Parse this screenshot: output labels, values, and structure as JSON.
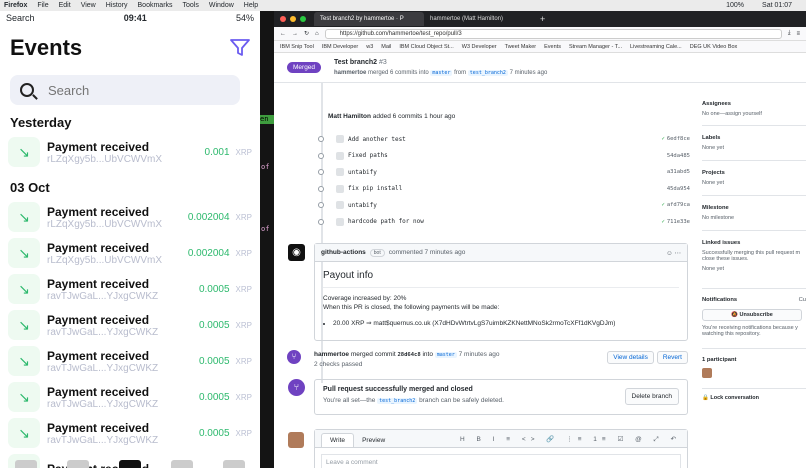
{
  "menubar": {
    "app": "Firefox",
    "items": [
      "File",
      "Edit",
      "View",
      "History",
      "Bookmarks",
      "Tools",
      "Window",
      "Help"
    ],
    "battery": "100%",
    "clock": "Sat 01:07"
  },
  "phone": {
    "status_left": "Search",
    "time": "09:41",
    "battery": "54%",
    "title": "Events",
    "search_placeholder": "Search",
    "sections": [
      {
        "label": "Yesterday",
        "rows": [
          {
            "title": "Payment received",
            "sub": "rLZqXgy5b...UbVCWVmX",
            "amount": "0.001",
            "unit": "XRP"
          }
        ]
      },
      {
        "label": "03 Oct",
        "rows": [
          {
            "title": "Payment received",
            "sub": "rLZqXgy5b...UbVCWVmX",
            "amount": "0.002004",
            "unit": "XRP"
          },
          {
            "title": "Payment received",
            "sub": "rLZqXgy5b...UbVCWVmX",
            "amount": "0.002004",
            "unit": "XRP"
          },
          {
            "title": "Payment received",
            "sub": "ravTJwGaL...YJxgCWKZ",
            "amount": "0.0005",
            "unit": "XRP"
          },
          {
            "title": "Payment received",
            "sub": "ravTJwGaL...YJxgCWKZ",
            "amount": "0.0005",
            "unit": "XRP"
          },
          {
            "title": "Payment received",
            "sub": "ravTJwGaL...YJxgCWKZ",
            "amount": "0.0005",
            "unit": "XRP"
          },
          {
            "title": "Payment received",
            "sub": "ravTJwGaL...YJxgCWKZ",
            "amount": "0.0005",
            "unit": "XRP"
          },
          {
            "title": "Payment received",
            "sub": "ravTJwGaL...YJxgCWKZ",
            "amount": "0.0005",
            "unit": "XRP"
          },
          {
            "title": "Payment received",
            "sub": "",
            "amount": "",
            "unit": ""
          }
        ]
      }
    ]
  },
  "strip": {
    "green_text": "en",
    "pink": [
      "of",
      "of"
    ]
  },
  "browser": {
    "tabs": [
      "Test branch2 by hammertoe · P",
      "hammertoe (Matt Hamilton)"
    ],
    "url": "https://github.com/hammertoe/test_repo/pull/3",
    "bookmarks": [
      "IBM Snip Tool",
      "IBM Developer",
      "w3",
      "Mail",
      "IBM Cloud Object St...",
      "W3 Developer",
      "Tweet Maker",
      "Events",
      "Stream Manager - T...",
      "Livestreaming Cale...",
      "DEG UK Video Box"
    ]
  },
  "pr": {
    "badge": "Merged",
    "title": "Test branch2",
    "number": "#3",
    "author": "hammertoe",
    "sub_mid": "merged 6 commits into",
    "base": "master",
    "from": "from",
    "head": "test_branch2",
    "when": "7 minutes ago"
  },
  "timeline": {
    "commits_header_user": "Matt Hamilton",
    "commits_header_text": "added 6 commits 1 hour ago",
    "commits": [
      {
        "msg": "Add another test",
        "sha": "6edf8ce",
        "ok": true
      },
      {
        "msg": "Fixed paths",
        "sha": "54da485",
        "ok": false
      },
      {
        "msg": "untabify",
        "sha": "a31abd5",
        "ok": false
      },
      {
        "msg": "fix pip install",
        "sha": "45da954",
        "ok": false
      },
      {
        "msg": "untabify",
        "sha": "afd79ca",
        "ok": true
      },
      {
        "msg": "hardcode path for now",
        "sha": "711e33e",
        "ok": true
      }
    ],
    "comment": {
      "author": "github-actions",
      "bot": "bot",
      "when": "commented 7 minutes ago",
      "heading": "Payout info",
      "line1": "Coverage increased by: 20%",
      "line2": "When this PR is closed, the following payments will be made:",
      "bullet": "20.00 XRP ⇒ matt$quernus.co.uk (X7dHDvWtrtvLgS7uimbKZKNettMNoSk2rmoTcXFf1dKVgDJm)"
    },
    "merge_event": {
      "user": "hammertoe",
      "text": "merged commit",
      "sha": "28d64c8",
      "into": "into",
      "branch": "master",
      "when": "7 minutes ago",
      "checks": "2 checks passed",
      "view_details": "View details",
      "revert": "Revert"
    },
    "merged_box": {
      "title": "Pull request successfully merged and closed",
      "text_pre": "You're all set—the",
      "branch": "test_branch2",
      "text_post": "branch can be safely deleted.",
      "delete": "Delete branch"
    },
    "editor": {
      "write": "Write",
      "preview": "Preview",
      "toolbar": "H B I ≡ <> 🔗 ⋮≡ 1≡ ☑ @ ⤢ ↶",
      "placeholder": "Leave a comment"
    }
  },
  "sidebar": {
    "assignees": "Assignees",
    "assignees_v": "No one—assign yourself",
    "labels": "Labels",
    "labels_v": "None yet",
    "projects": "Projects",
    "projects_v": "None yet",
    "milestone": "Milestone",
    "milestone_v": "No milestone",
    "linked": "Linked issues",
    "linked_t": "Successfully merging this pull request m close these issues.",
    "linked_v": "None yet",
    "notifications": "Notifications",
    "cust": "Cu",
    "unsubscribe": "Unsubscribe",
    "notif_t": "You're receiving notifications because y watching this repository.",
    "participants": "1 participant",
    "lock": "Lock conversation"
  }
}
